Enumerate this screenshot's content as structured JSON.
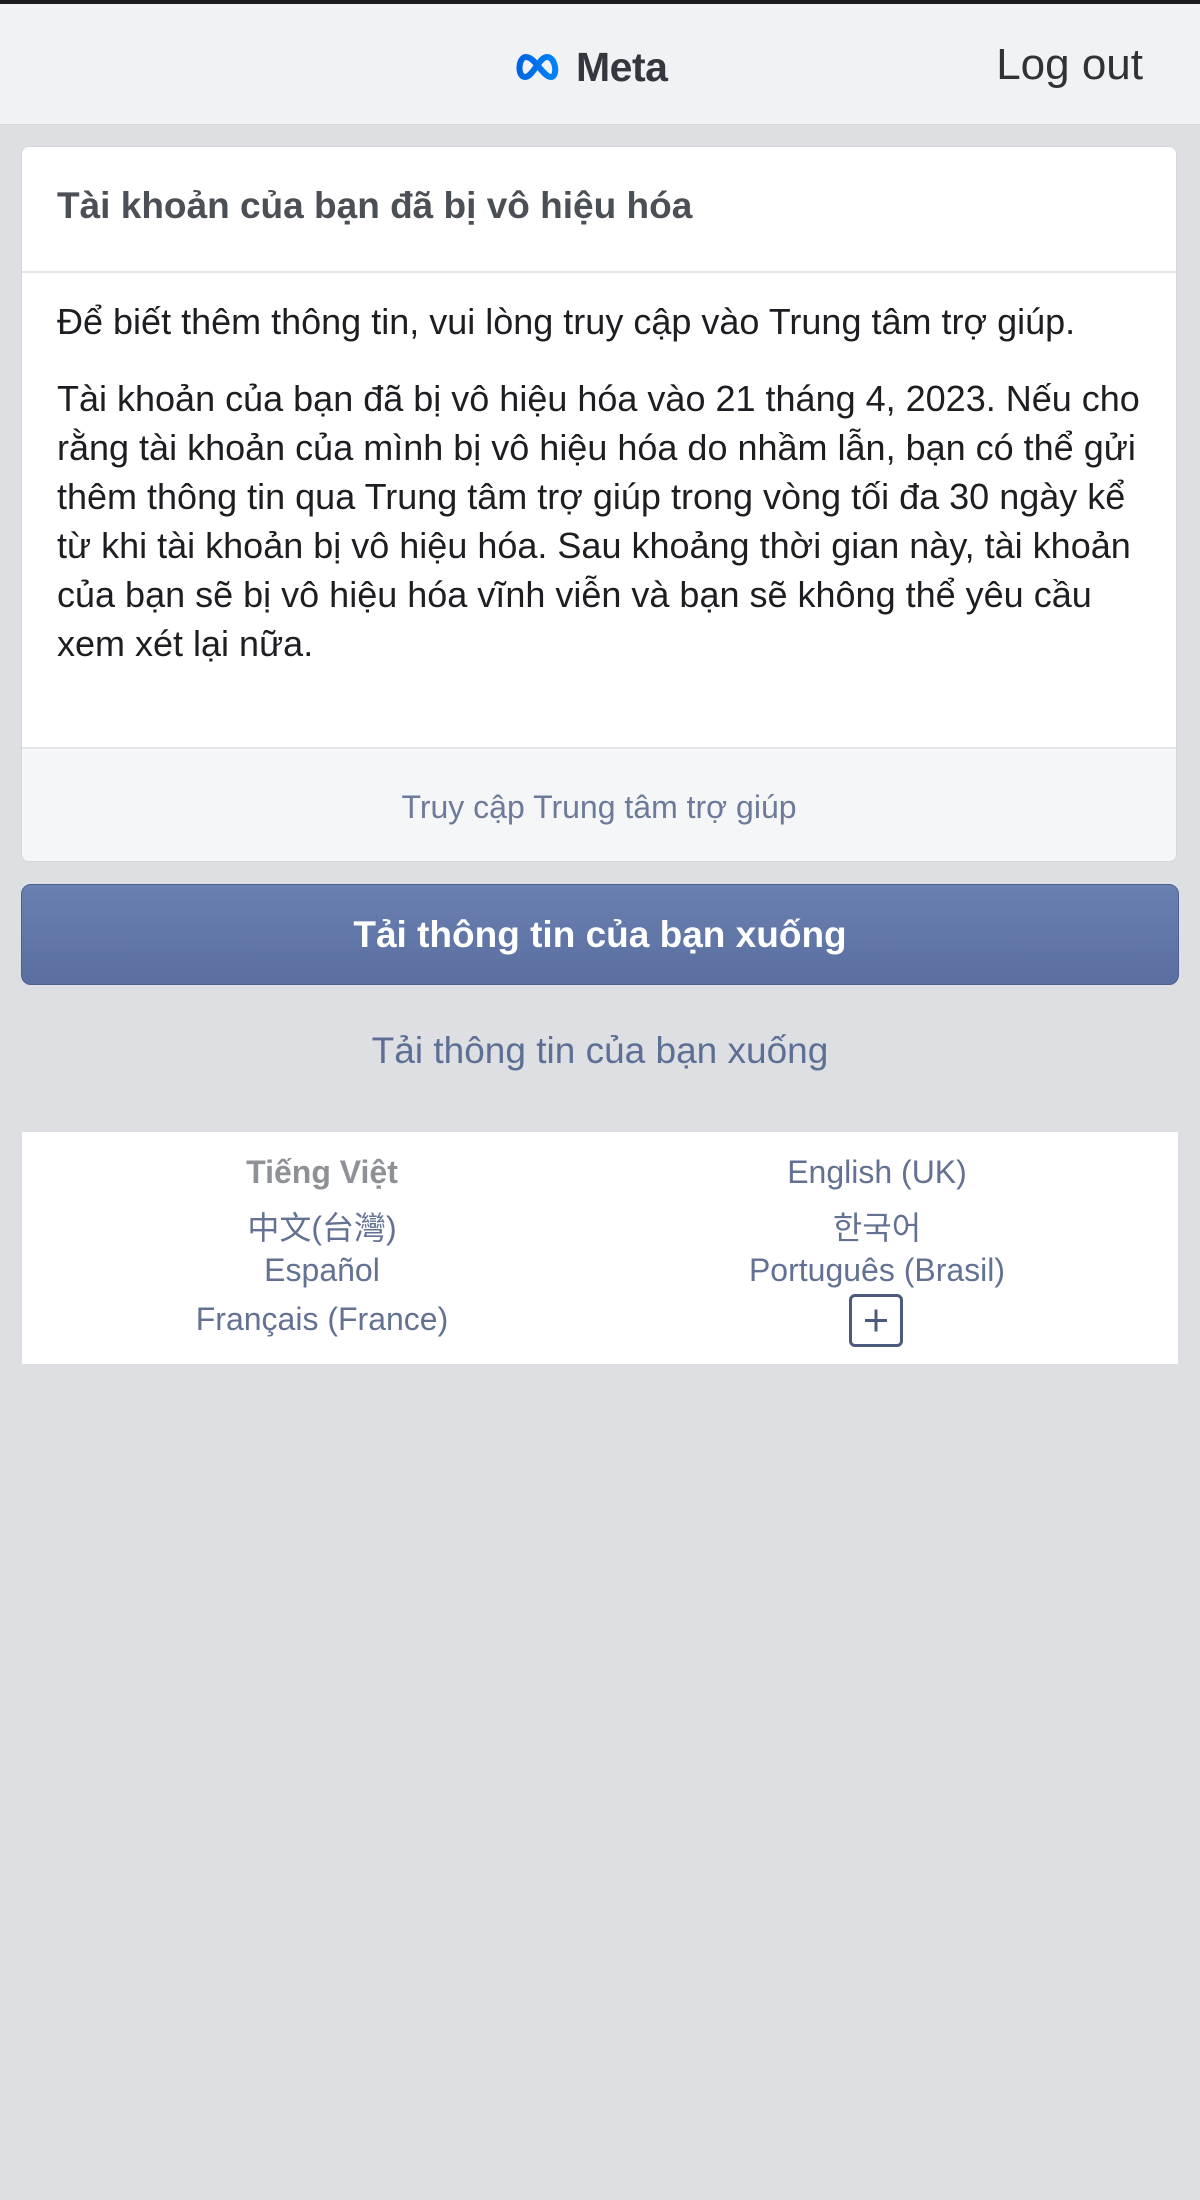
{
  "header": {
    "brand": "Meta",
    "logout_label": "Log out"
  },
  "notice": {
    "title": "Tài khoản của bạn đã bị vô hiệu hóa",
    "paragraph_1": "Để biết thêm thông tin, vui lòng truy cập vào Trung tâm trợ giúp.",
    "paragraph_2": "Tài khoản của bạn đã bị vô hiệu hóa vào 21 tháng 4, 2023. Nếu cho rằng tài khoản của mình bị vô hiệu hóa do nhầm lẫn, bạn có thể gửi thêm thông tin qua Trung tâm trợ giúp trong vòng tối đa 30 ngày kể từ khi tài khoản bị vô hiệu hóa. Sau khoảng thời gian này, tài khoản của bạn sẽ bị vô hiệu hóa vĩnh viễn và bạn sẽ không thể yêu cầu xem xét lại nữa.",
    "help_link": "Truy cập Trung tâm trợ giúp"
  },
  "actions": {
    "download_button": "Tải thông tin của bạn xuống",
    "download_link": "Tải thông tin của bạn xuống"
  },
  "languages": {
    "current": "Tiếng Việt",
    "items": [
      "English (UK)",
      "中文(台灣)",
      "한국어",
      "Español",
      "Português (Brasil)",
      "Français (France)"
    ],
    "more_icon": "plus-icon"
  },
  "colors": {
    "page_bg": "#dddfe3",
    "header_bg": "#f1f2f4",
    "button_bg": "#5f74a5",
    "link": "#637193"
  }
}
